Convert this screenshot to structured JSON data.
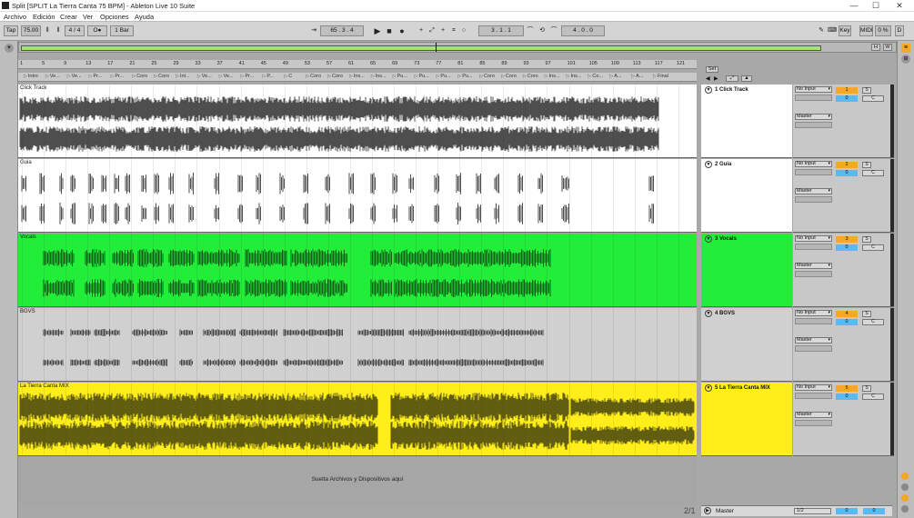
{
  "window": {
    "title": "Split  [SPLIT La Tierra Canta 75 BPM] - Ableton Live 10 Suite",
    "minimize": "—",
    "maximize": "☐",
    "close": "✕"
  },
  "menu": [
    "Archivo",
    "Edición",
    "Crear",
    "Ver",
    "Opciones",
    "Ayuda"
  ],
  "control": {
    "tap": "Tap",
    "tempo": "75.00",
    "signature": "4 / 4",
    "metronome": "O●",
    "quantize": "1 Bar",
    "position": "65 .  3 .  4",
    "loop_start": "3 .  1 .  1",
    "loop_length": "4 .  0 .  0",
    "key": "Key",
    "midi": "MIDI",
    "cpu": "0 %",
    "disk": "D"
  },
  "overview": {
    "h_label": "H",
    "w_label": "W"
  },
  "ruler": [
    "1",
    "5",
    "9",
    "13",
    "17",
    "21",
    "25",
    "29",
    "33",
    "37",
    "41",
    "45",
    "49",
    "53",
    "57",
    "61",
    "65",
    "69",
    "73",
    "77",
    "81",
    "85",
    "89",
    "93",
    "97",
    "101",
    "105",
    "109",
    "113",
    "117",
    "121"
  ],
  "set_label": "Set",
  "locators": [
    "Intro",
    "Ve...",
    "Ve...",
    "Pr...",
    "Pr...",
    "Coro",
    "Coro",
    "Int...",
    "Ve...",
    "Ve...",
    "Pr...",
    "P...",
    "C",
    "Coro",
    "Coro",
    "Ins...",
    "Ins...",
    "Pu...",
    "Pu...",
    "Pu...",
    "Pu...",
    "Coro",
    "Coro",
    "Coro",
    "Ins...",
    "Ins...",
    "Co...",
    "A...",
    "A...",
    "Final"
  ],
  "tracks": [
    {
      "clip": "Click Track",
      "name": "1 Click Track",
      "color": "#ffffff",
      "input": "No Input",
      "output": "Master",
      "num": "1",
      "vol": "0",
      "solo": "S",
      "cue": "C"
    },
    {
      "clip": "Guia",
      "name": "2 Guia",
      "color": "#ffffff",
      "input": "No Input",
      "output": "Master",
      "num": "2",
      "vol": "0",
      "solo": "S",
      "cue": "C"
    },
    {
      "clip": "Vocals",
      "name": "3 Vocals",
      "color": "#22ee3a",
      "input": "No Input",
      "output": "Master",
      "num": "3",
      "vol": "0",
      "solo": "S",
      "cue": "C"
    },
    {
      "clip": "BGVS",
      "name": "4 BGVS",
      "color": "#d0d0d0",
      "input": "No Input",
      "output": "Master",
      "num": "4",
      "vol": "0",
      "solo": "S",
      "cue": "C"
    },
    {
      "clip": "La Tierra Canta MIX",
      "name": "5 La Tierra Canta MIX",
      "color": "#ffee1a",
      "input": "No Input",
      "output": "Master",
      "num": "5",
      "vol": "0",
      "solo": "S",
      "cue": "C"
    }
  ],
  "dropzone": "Suelta Archivos y Dispositivos aquí",
  "page_indicator": "2/1",
  "master": {
    "name": "Master",
    "output": "1/2",
    "vol": "0",
    "pan": "0"
  }
}
